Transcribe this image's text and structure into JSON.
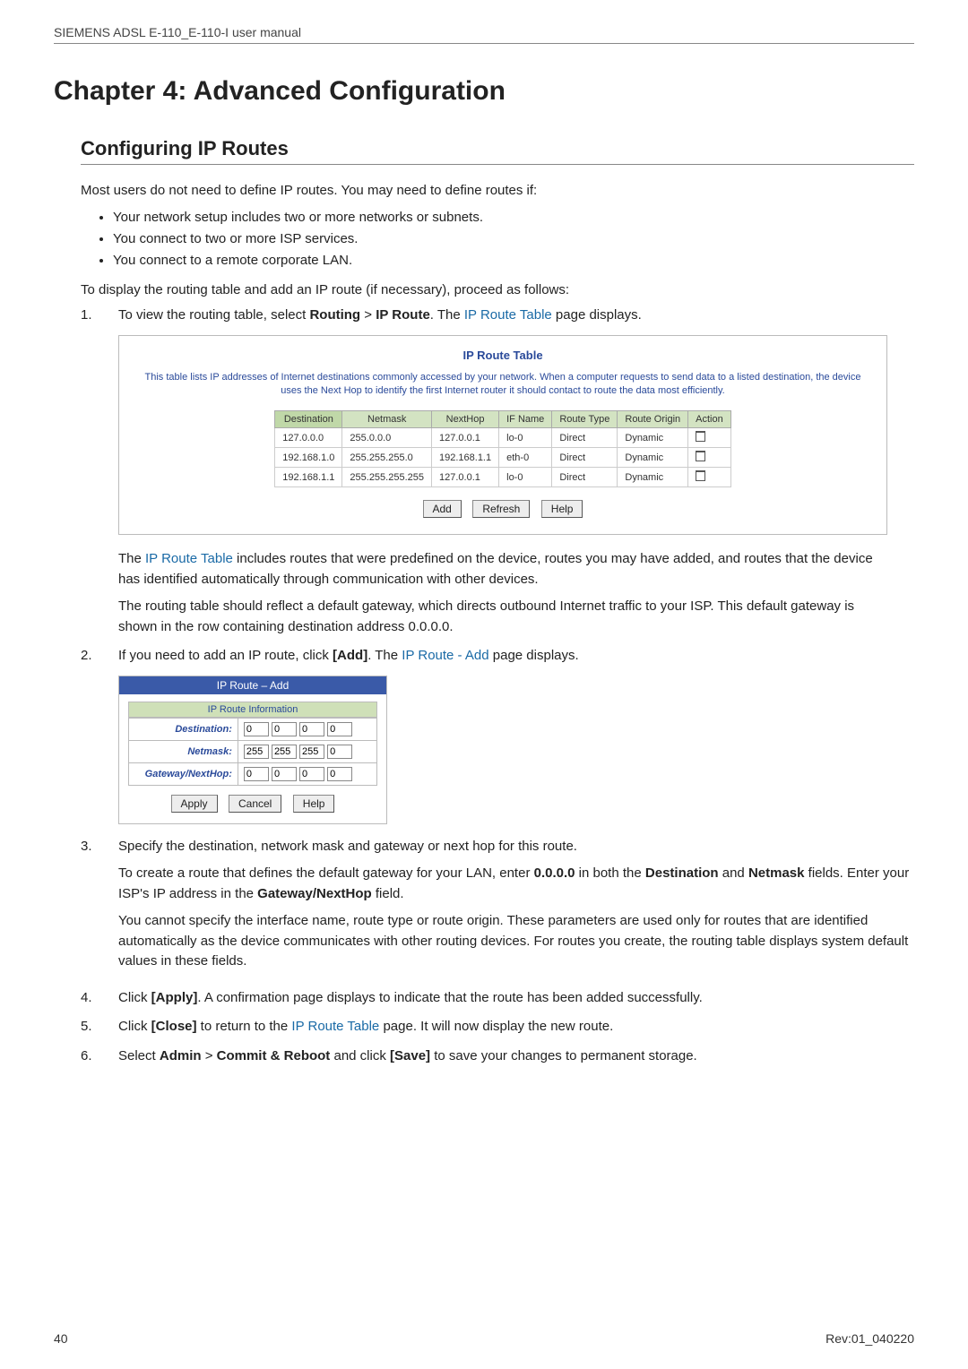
{
  "header": "SIEMENS ADSL E-110_E-110-I user manual",
  "chapter_title": "Chapter 4: Advanced Configuration",
  "section_title": "Configuring IP Routes",
  "intro": "Most users do not need to define IP routes. You may need to define routes if:",
  "bullets": [
    "Your network setup includes two or more networks or subnets.",
    "You connect to two or more ISP services.",
    "You connect to a remote corporate LAN."
  ],
  "lead_in": "To display the routing table and add an IP route (if necessary), proceed as follows:",
  "step1": {
    "num": "1.",
    "a": "To view the routing table, select ",
    "b": "Routing",
    "c": " > ",
    "d": "IP Route",
    "e": ". The ",
    "f": "IP Route Table",
    "g": " page displays."
  },
  "route_fig": {
    "title": "IP Route Table",
    "desc": "This table lists IP addresses of Internet destinations commonly accessed by your network. When a computer requests to send data to a listed destination, the device uses the Next Hop to identify the first Internet router it should contact to route the data most efficiently.",
    "headers": [
      "Destination",
      "Netmask",
      "NextHop",
      "IF Name",
      "Route Type",
      "Route Origin",
      "Action"
    ],
    "rows": [
      [
        "127.0.0.0",
        "255.0.0.0",
        "127.0.0.1",
        "lo-0",
        "Direct",
        "Dynamic"
      ],
      [
        "192.168.1.0",
        "255.255.255.0",
        "192.168.1.1",
        "eth-0",
        "Direct",
        "Dynamic"
      ],
      [
        "192.168.1.1",
        "255.255.255.255",
        "127.0.0.1",
        "lo-0",
        "Direct",
        "Dynamic"
      ]
    ],
    "buttons": {
      "add": "Add",
      "refresh": "Refresh",
      "help": "Help"
    }
  },
  "step1_after": {
    "p1a": "The ",
    "p1b": "IP Route Table",
    "p1c": " includes routes that were predefined on the device, routes you may have added, and routes that the device has identified automatically through communication with other devices.",
    "p2": "The routing table should reflect a default gateway, which directs outbound Internet traffic to your ISP. This default gateway is shown in the row containing destination address 0.0.0.0."
  },
  "step2": {
    "num": "2.",
    "a": "If you need to add an IP route, click ",
    "b": "[Add]",
    "c": ". The ",
    "d": "IP Route - Add",
    "e": " page displays."
  },
  "add_fig": {
    "title": "IP Route – Add",
    "subtitle": "IP Route Information",
    "rows": [
      {
        "label": "Destination:",
        "vals": [
          "0",
          "0",
          "0",
          "0"
        ]
      },
      {
        "label": "Netmask:",
        "vals": [
          "255",
          "255",
          "255",
          "0"
        ]
      },
      {
        "label": "Gateway/NextHop:",
        "vals": [
          "0",
          "0",
          "0",
          "0"
        ]
      }
    ],
    "buttons": {
      "apply": "Apply",
      "cancel": "Cancel",
      "help": "Help"
    }
  },
  "step3": {
    "num": "3.",
    "p1a": "Specify the destination, network mask and gateway or next hop for this route.",
    "p2a": "To create a route that defines the default gateway for your LAN, enter ",
    "p2b": "0.0.0.0",
    "p2c": " in both the ",
    "p2d": "Destination",
    "p2e": " and ",
    "p2f": "Netmask",
    "p2g": " fields. Enter your ISP's IP address in the ",
    "p2h": "Gateway/NextHop",
    "p2i": " field.",
    "p3": "You cannot specify the interface name, route type or route origin. These parameters are used only for routes that are identified automatically as the device communicates with other routing devices. For routes you create, the routing table displays system default values in these fields."
  },
  "step4": {
    "num": "4.",
    "a": "Click ",
    "b": "[Apply]",
    "c": ". A confirmation page displays to indicate that the route has been added successfully."
  },
  "step5": {
    "num": "5.",
    "a": "Click ",
    "b": "[Close]",
    "c": " to return to the ",
    "d": "IP Route Table",
    "e": " page. It will now display the new route."
  },
  "step6": {
    "num": "6.",
    "a": "Select ",
    "b": "Admin",
    "c": " > ",
    "d": "Commit & Reboot",
    "e": " and click ",
    "f": "[Save]",
    "g": " to save your changes to permanent storage."
  },
  "footer": {
    "left": "40",
    "right": "Rev:01_040220"
  }
}
